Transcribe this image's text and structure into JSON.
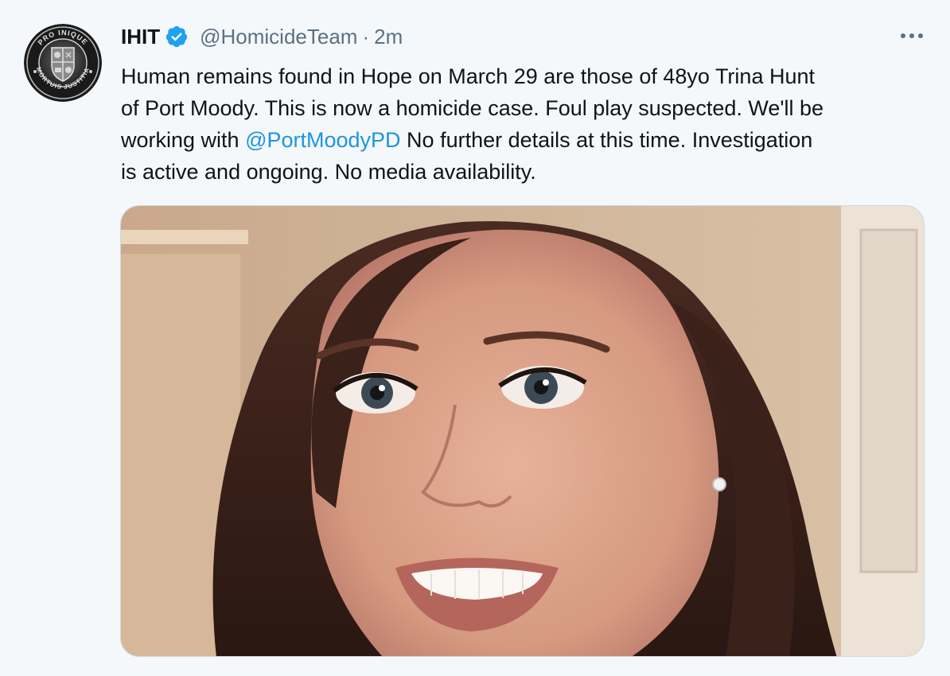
{
  "tweet": {
    "author": {
      "display_name": "IHIT",
      "handle": "@HomicideTeam",
      "verified_icon": "verified-badge-icon",
      "avatar": {
        "icon": "police-crest-icon",
        "ring_text_top": "PRO INIQUE",
        "ring_text_bottom": "MORTUIS JUSTITIA"
      }
    },
    "separator": "·",
    "timestamp": "2m",
    "more_icon": "more-horizontal-icon",
    "text": {
      "line1": "Human remains found in Hope on March 29 are those of 48yo Trina Hunt",
      "line2": "of Port Moody. This is now a homicide case. Foul play suspected. We'll be",
      "line3_before": "working with ",
      "line3_mention": "@PortMoodyPD",
      "line3_after": " No further details at this time. Investigation",
      "line4": "is active and ongoing. No media availability."
    },
    "media": {
      "kind": "photo",
      "subject": "portrait-photo"
    }
  },
  "colors": {
    "background": "#f5f8fa",
    "text": "#0f1419",
    "secondary_text": "#5b7083",
    "link": "#1b95e0",
    "verified": "#1da1f2",
    "border": "#cfd9de"
  }
}
